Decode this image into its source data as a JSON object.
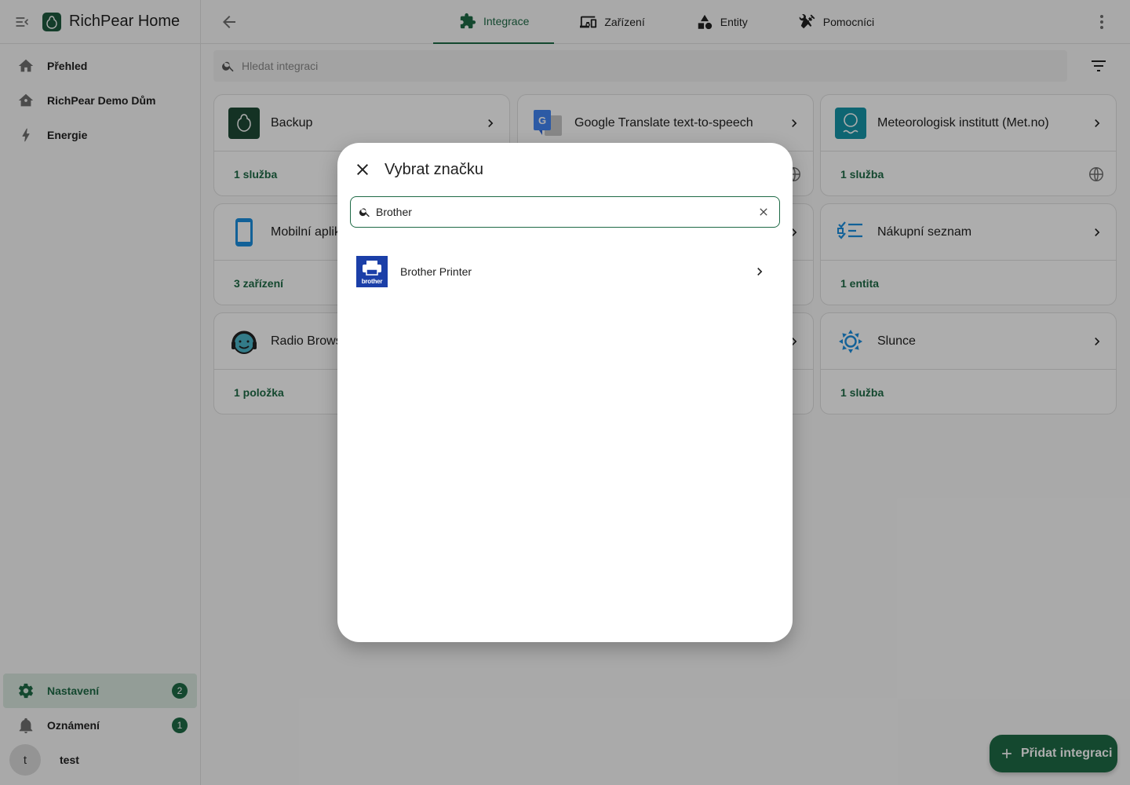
{
  "app": {
    "title": "RichPear Home"
  },
  "sidebar": {
    "items": [
      {
        "label": "Přehled",
        "icon": "home-icon"
      },
      {
        "label": "RichPear Demo Dům",
        "icon": "home-outline-icon"
      },
      {
        "label": "Energie",
        "icon": "lightning-icon"
      }
    ],
    "bottom": [
      {
        "label": "Nastavení",
        "icon": "gear-icon",
        "badge": "2"
      },
      {
        "label": "Oznámení",
        "icon": "bell-icon",
        "badge": "1"
      }
    ],
    "user": {
      "initial": "t",
      "name": "test"
    }
  },
  "tabs": [
    {
      "label": "Integrace",
      "icon": "puzzle-icon",
      "active": true
    },
    {
      "label": "Zařízení",
      "icon": "devices-icon"
    },
    {
      "label": "Entity",
      "icon": "shapes-icon"
    },
    {
      "label": "Pomocníci",
      "icon": "tools-icon"
    }
  ],
  "search": {
    "placeholder": "Hledat integraci"
  },
  "cards": [
    {
      "name": "Backup",
      "footer": "1 služba"
    },
    {
      "name": "Google Translate text-to-speech",
      "footer": ""
    },
    {
      "name": "Meteorologisk institutt (Met.no)",
      "footer": "1 služba"
    },
    {
      "name": "Mobilní aplik",
      "footer": "3 zařízení"
    },
    {
      "name": "",
      "footer": ""
    },
    {
      "name": "Nákupní seznam",
      "footer": "1 entita"
    },
    {
      "name": "Radio Brows",
      "footer": "1 položka"
    },
    {
      "name": "",
      "footer": ""
    },
    {
      "name": "Slunce",
      "footer": "1 služba"
    }
  ],
  "fab": {
    "label": "Přidat integraci"
  },
  "dialog": {
    "title": "Vybrat značku",
    "search_value": "Brother",
    "results": [
      {
        "name": "Brother Printer",
        "logo_text": "brother"
      }
    ]
  },
  "colors": {
    "primary": "#1e6a46",
    "brand_logo": "#1b3fa8"
  }
}
